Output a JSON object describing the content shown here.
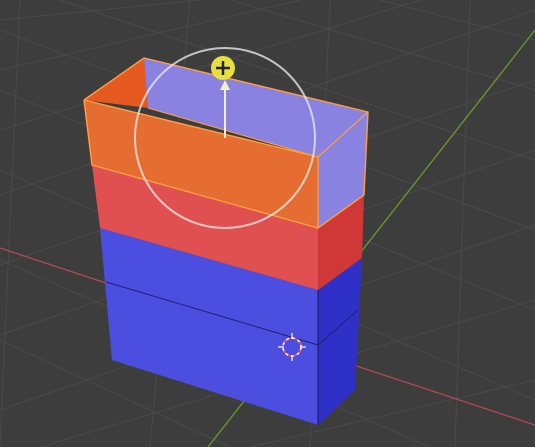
{
  "viewport": {
    "background": "#3d3d3d",
    "grid_color": "#4a4a4a",
    "x_axis_color": "#b04a55",
    "y_axis_color": "#6a9a2a"
  },
  "mesh": {
    "lower_block_color": "#4c4ee0",
    "lower_block_side_color": "#2e30c8",
    "middle_band_color": "#e05050",
    "selected_top_color": "#ee7030",
    "selected_inner_color": "#8f88ee",
    "selection_outline_color": "#ffa040"
  },
  "gizmo": {
    "icon": "move-gizmo-icon",
    "handle_color": "#e8e040",
    "ring_color": "#e6e6e6"
  },
  "cursor_3d": {
    "icon": "3d-cursor-icon"
  }
}
